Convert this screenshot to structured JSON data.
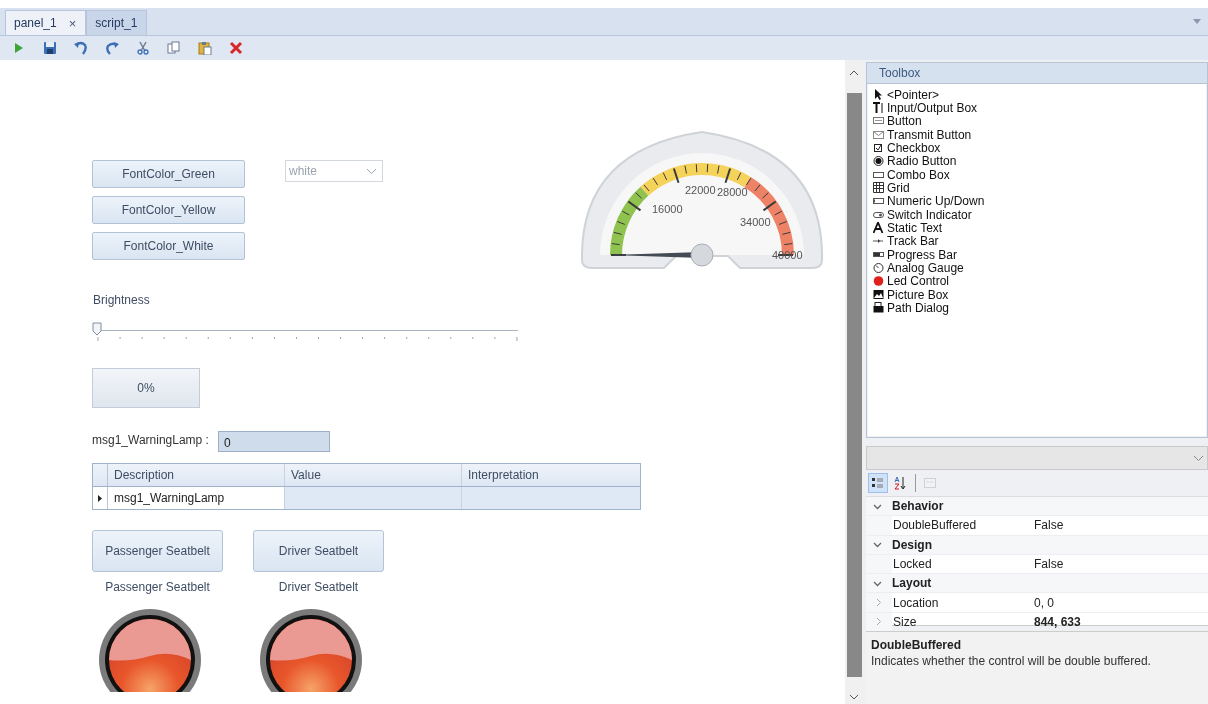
{
  "tabs": [
    {
      "label": "panel_1",
      "selected": true,
      "close": "×"
    },
    {
      "label": "script_1",
      "selected": false
    }
  ],
  "canvas": {
    "font_buttons": [
      "FontColor_Green",
      "FontColor_Yellow",
      "FontColor_White"
    ],
    "combo": {
      "value": "white",
      "disabled": true
    },
    "gauge": {
      "labels": [
        "16000",
        "22000",
        "28000",
        "34000",
        "40000"
      ]
    },
    "brightness": {
      "label": "Brightness",
      "level": 0
    },
    "progress": {
      "text": "0%",
      "level": 0
    },
    "signal": {
      "label": "msg1_WarningLamp :",
      "value": "0"
    },
    "grid": {
      "columns": [
        "Description",
        "Value",
        "Interpretation"
      ],
      "rows": [
        {
          "selected": true,
          "cells": [
            "msg1_WarningLamp",
            "",
            ""
          ]
        }
      ]
    },
    "switches": [
      {
        "button": "Passenger Seatbelt",
        "caption": "Passenger Seatbelt"
      },
      {
        "button": "Driver Seatbelt",
        "caption": "Driver Seatbelt"
      }
    ]
  },
  "toolbox": {
    "title": "Toolbox",
    "items": [
      {
        "label": "<Pointer>",
        "kind": "pointer"
      },
      {
        "label": "Input/Output Box",
        "kind": "io"
      },
      {
        "label": "Button",
        "kind": "button"
      },
      {
        "label": "Transmit Button",
        "kind": "transmit"
      },
      {
        "label": "Checkbox",
        "kind": "checkbox"
      },
      {
        "label": "Radio Button",
        "kind": "radio"
      },
      {
        "label": "Combo Box",
        "kind": "combo"
      },
      {
        "label": "Grid",
        "kind": "grid"
      },
      {
        "label": "Numeric Up/Down",
        "kind": "numeric"
      },
      {
        "label": "Switch Indicator",
        "kind": "switch"
      },
      {
        "label": "Static Text",
        "kind": "text"
      },
      {
        "label": "Track Bar",
        "kind": "track"
      },
      {
        "label": "Progress Bar",
        "kind": "progress"
      },
      {
        "label": "Analog Gauge",
        "kind": "gauge"
      },
      {
        "label": "Led Control",
        "kind": "led"
      },
      {
        "label": "Picture Box",
        "kind": "picture"
      },
      {
        "label": "Path Dialog",
        "kind": "path"
      }
    ]
  },
  "properties": {
    "view_buttons": [
      {
        "kind": "categorized",
        "selected": true,
        "disabled": false
      },
      {
        "kind": "alphabetical",
        "selected": false,
        "disabled": false
      },
      {
        "kind": "pages",
        "selected": false,
        "disabled": true
      }
    ],
    "categories": [
      {
        "name": "Behavior",
        "expanded": true,
        "rows": [
          {
            "name": "DoubleBuffered",
            "value": "False",
            "modified": false,
            "expandable": false
          }
        ]
      },
      {
        "name": "Design",
        "expanded": true,
        "rows": [
          {
            "name": "Locked",
            "value": "False",
            "modified": false,
            "expandable": false
          }
        ]
      },
      {
        "name": "Layout",
        "expanded": true,
        "rows": [
          {
            "name": "Location",
            "value": "0, 0",
            "modified": false,
            "expandable": true
          },
          {
            "name": "Size",
            "value": "844, 633",
            "modified": true,
            "expandable": true
          }
        ]
      }
    ],
    "description": {
      "title": "DoubleBuffered",
      "text": "Indicates whether the control will be double buffered."
    }
  }
}
